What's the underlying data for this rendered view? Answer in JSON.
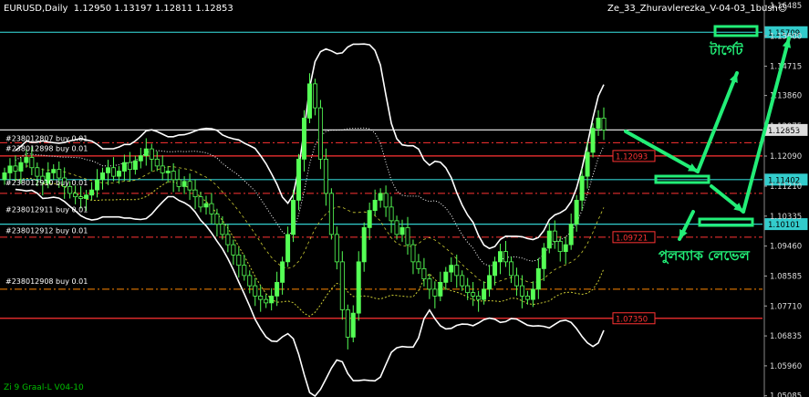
{
  "window": {
    "symbol_line": "EURUSD,Daily",
    "ohlc": "1.12950 1.13197 1.12811 1.12853",
    "indicator_name": "Ze_33_Zhuravlerezka_V-04-03_1bush",
    "smiley": "☺",
    "footer_label": "Zi 9 Graal-L V04-10"
  },
  "colors": {
    "background": "#000000",
    "candles": "#55ff55",
    "bands": "#ffffff",
    "arrows": "#22ee77",
    "cyan_levels": "#33cccc",
    "red_levels": "#ff3333",
    "orange_levels": "#ff8800",
    "mid_line": "#cccc33"
  },
  "chart_data": {
    "type": "candlestick",
    "y_axis_ticks": [
      "1.16485",
      "1.15600",
      "1.14715",
      "1.13860",
      "1.12975",
      "1.12090",
      "1.11210",
      "1.10335",
      "1.09460",
      "1.08585",
      "1.07710",
      "1.06835",
      "1.05960",
      "1.05085"
    ],
    "ylim": [
      1.0505,
      1.1665
    ],
    "price_labels": [
      {
        "value": "1.15709",
        "color": "cyan"
      },
      {
        "value": "1.12853",
        "color": "white"
      },
      {
        "value": "1.12093",
        "color": "red"
      },
      {
        "value": "1.11402",
        "color": "cyan"
      },
      {
        "value": "1.10101",
        "color": "cyan"
      },
      {
        "value": "1.09721",
        "color": "red"
      },
      {
        "value": "1.07350",
        "color": "red"
      }
    ],
    "horizontal_levels": [
      {
        "price": 1.15709,
        "color": "cyan",
        "style": "solid"
      },
      {
        "price": 1.12853,
        "color": "white",
        "style": "solid"
      },
      {
        "price": 1.1248,
        "color": "red",
        "style": "dashdot"
      },
      {
        "price": 1.12093,
        "color": "red",
        "style": "solid"
      },
      {
        "price": 1.11402,
        "color": "cyan",
        "style": "solid"
      },
      {
        "price": 1.11,
        "color": "red",
        "style": "dashdot"
      },
      {
        "price": 1.10101,
        "color": "cyan",
        "style": "solid"
      },
      {
        "price": 1.09721,
        "color": "red",
        "style": "dashdot"
      },
      {
        "price": 1.082,
        "color": "orange",
        "style": "dashdot"
      },
      {
        "price": 1.0735,
        "color": "red",
        "style": "solid"
      }
    ],
    "order_labels": [
      {
        "text": "#238012807 buy 0.01",
        "price": 1.1248
      },
      {
        "text": "#238012898 buy 0.01",
        "price": 1.1218
      },
      {
        "text": "#238012910 buy 0.01",
        "price": 1.1118
      },
      {
        "text": "#238012911 buy 0.01",
        "price": 1.104
      },
      {
        "text": "#238012912 buy 0.01",
        "price": 1.0978
      },
      {
        "text": "#238012908 buy 0.01",
        "price": 1.083
      }
    ],
    "annotations": [
      {
        "text": "টার্গেট"
      },
      {
        "text": "পুলব্যাক লেভেল"
      }
    ],
    "close_series": [
      1.116,
      1.118,
      1.1165,
      1.119,
      1.1205,
      1.1175,
      1.115,
      1.113,
      1.116,
      1.117,
      1.1145,
      1.112,
      1.11,
      1.109,
      1.1085,
      1.1095,
      1.111,
      1.114,
      1.116,
      1.1175,
      1.115,
      1.1165,
      1.119,
      1.117,
      1.1195,
      1.121,
      1.123,
      1.12,
      1.118,
      1.116,
      1.1165,
      1.114,
      1.112,
      1.1135,
      1.111,
      1.109,
      1.106,
      1.107,
      1.104,
      1.101,
      1.098,
      1.095,
      1.092,
      1.089,
      1.086,
      1.083,
      1.08,
      1.079,
      1.078,
      1.08,
      1.084,
      1.09,
      1.098,
      1.108,
      1.12,
      1.132,
      1.142,
      1.135,
      1.12,
      1.11,
      1.098,
      1.09,
      1.076,
      1.068,
      1.075,
      1.09,
      1.1,
      1.105,
      1.108,
      1.11,
      1.106,
      1.102,
      1.098,
      1.1,
      1.095,
      1.09,
      1.088,
      1.085,
      1.082,
      1.08,
      1.084,
      1.087,
      1.089,
      1.086,
      1.083,
      1.081,
      1.08,
      1.079,
      1.082,
      1.086,
      1.09,
      1.093,
      1.09,
      1.086,
      1.083,
      1.08,
      1.079,
      1.082,
      1.088,
      1.094,
      1.099,
      1.096,
      1.093,
      1.095,
      1.101,
      1.108,
      1.115,
      1.122,
      1.129,
      1.132,
      1.1285
    ]
  }
}
